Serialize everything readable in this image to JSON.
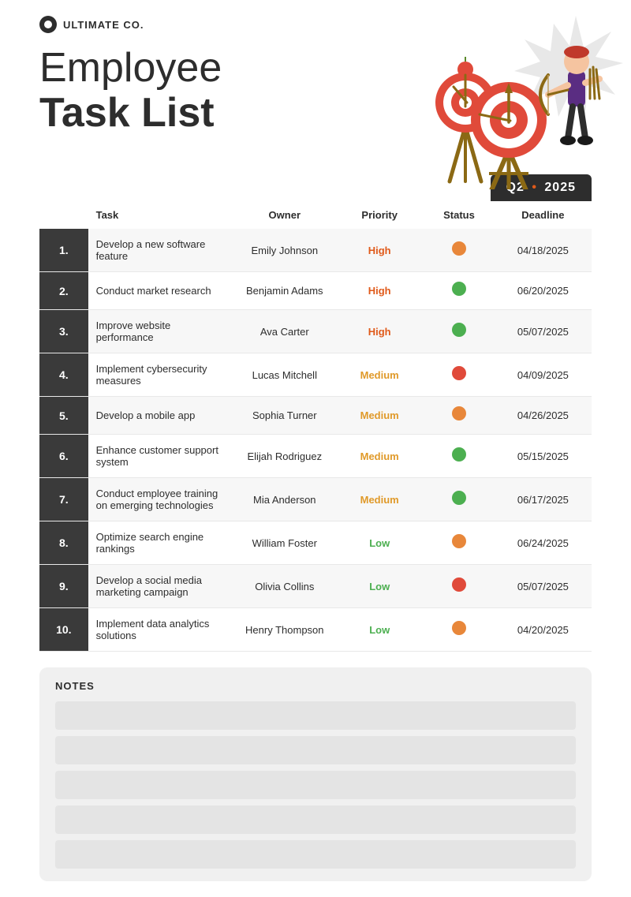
{
  "company": {
    "name": "ULTIMATE CO."
  },
  "header": {
    "title_line1": "Employee",
    "title_line2": "Task List",
    "quarter": "Q2",
    "year": "2025",
    "dot": "•"
  },
  "table": {
    "columns": {
      "task": "Task",
      "owner": "Owner",
      "priority": "Priority",
      "status": "Status",
      "deadline": "Deadline"
    },
    "rows": [
      {
        "num": "1.",
        "task": "Develop a new software feature",
        "owner": "Emily Johnson",
        "priority": "High",
        "priority_class": "priority-high",
        "status_class": "dot-orange",
        "deadline": "04/18/2025"
      },
      {
        "num": "2.",
        "task": "Conduct market research",
        "owner": "Benjamin Adams",
        "priority": "High",
        "priority_class": "priority-high",
        "status_class": "dot-green",
        "deadline": "06/20/2025"
      },
      {
        "num": "3.",
        "task": "Improve website performance",
        "owner": "Ava Carter",
        "priority": "High",
        "priority_class": "priority-high",
        "status_class": "dot-green",
        "deadline": "05/07/2025"
      },
      {
        "num": "4.",
        "task": "Implement cybersecurity measures",
        "owner": "Lucas Mitchell",
        "priority": "Medium",
        "priority_class": "priority-medium",
        "status_class": "dot-red",
        "deadline": "04/09/2025"
      },
      {
        "num": "5.",
        "task": "Develop a mobile app",
        "owner": "Sophia Turner",
        "priority": "Medium",
        "priority_class": "priority-medium",
        "status_class": "dot-orange",
        "deadline": "04/26/2025"
      },
      {
        "num": "6.",
        "task": "Enhance customer support system",
        "owner": "Elijah Rodriguez",
        "priority": "Medium",
        "priority_class": "priority-medium",
        "status_class": "dot-green",
        "deadline": "05/15/2025"
      },
      {
        "num": "7.",
        "task": "Conduct employee training on emerging technologies",
        "owner": "Mia Anderson",
        "priority": "Medium",
        "priority_class": "priority-medium",
        "status_class": "dot-green",
        "deadline": "06/17/2025"
      },
      {
        "num": "8.",
        "task": "Optimize search engine rankings",
        "owner": "William Foster",
        "priority": "Low",
        "priority_class": "priority-low",
        "status_class": "dot-orange",
        "deadline": "06/24/2025"
      },
      {
        "num": "9.",
        "task": "Develop a social media marketing campaign",
        "owner": "Olivia Collins",
        "priority": "Low",
        "priority_class": "priority-low",
        "status_class": "dot-red",
        "deadline": "05/07/2025"
      },
      {
        "num": "10.",
        "task": "Implement data analytics solutions",
        "owner": "Henry Thompson",
        "priority": "Low",
        "priority_class": "priority-low",
        "status_class": "dot-orange",
        "deadline": "04/20/2025"
      }
    ]
  },
  "notes": {
    "title": "NOTES",
    "lines": 5
  }
}
